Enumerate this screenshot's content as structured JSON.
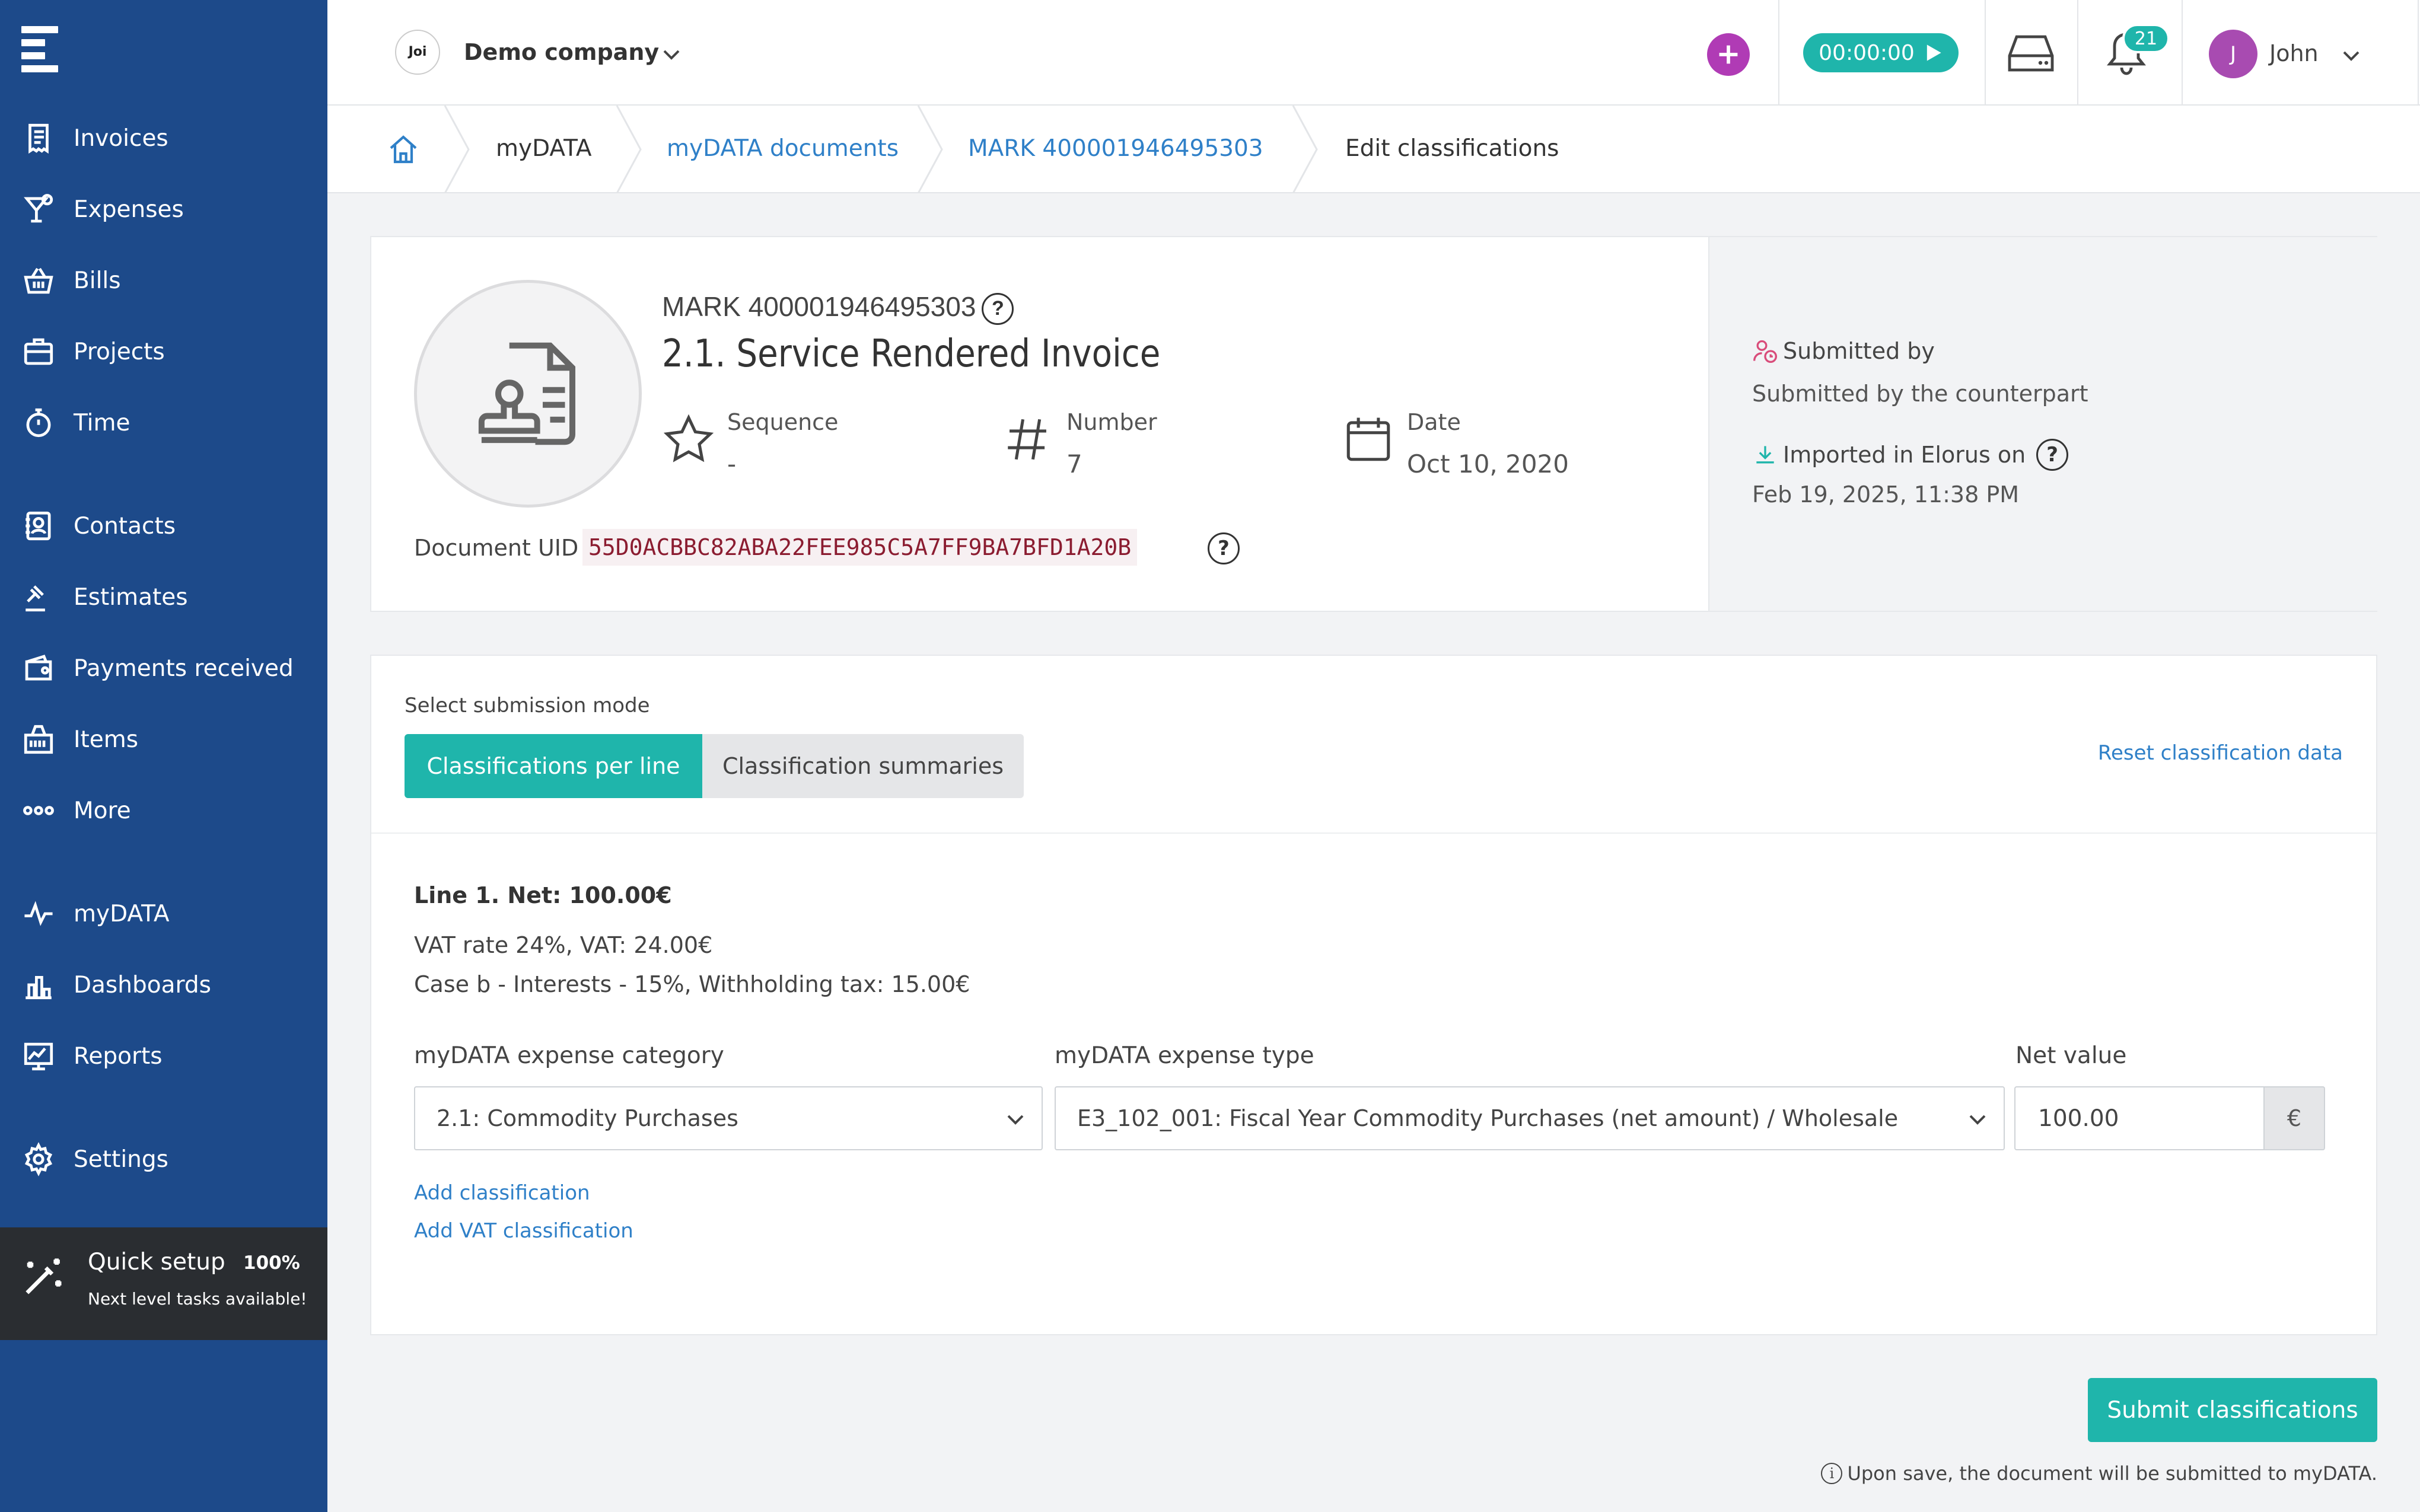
{
  "sidebar": {
    "items": [
      {
        "label": "Invoices",
        "icon": "invoice-icon"
      },
      {
        "label": "Expenses",
        "icon": "cocktail-icon"
      },
      {
        "label": "Bills",
        "icon": "basket-icon"
      },
      {
        "label": "Projects",
        "icon": "briefcase-icon"
      },
      {
        "label": "Time",
        "icon": "stopwatch-icon"
      },
      {
        "label": "Contacts",
        "icon": "contact-book-icon"
      },
      {
        "label": "Estimates",
        "icon": "gavel-icon"
      },
      {
        "label": "Payments received",
        "icon": "wallet-icon"
      },
      {
        "label": "Items",
        "icon": "items-icon"
      },
      {
        "label": "More",
        "icon": "more-dots-icon"
      },
      {
        "label": "myDATA",
        "icon": "pulse-icon"
      },
      {
        "label": "Dashboards",
        "icon": "dashboard-icon"
      },
      {
        "label": "Reports",
        "icon": "report-icon"
      },
      {
        "label": "Settings",
        "icon": "gear-icon"
      }
    ],
    "quick_setup": {
      "title": "Quick setup",
      "percent": "100%",
      "subtitle": "Next level tasks available!"
    }
  },
  "topbar": {
    "company_logo_text": "Joi",
    "company_name": "Demo company",
    "timer": "00:00:00",
    "notifications_count": "21",
    "avatar_initial": "J",
    "user_name": "John"
  },
  "breadcrumb": {
    "items": [
      "myDATA",
      "myDATA documents",
      "MARK 400001946495303",
      "Edit classifications"
    ]
  },
  "document": {
    "mark": "MARK 400001946495303",
    "title": "2.1. Service Rendered Invoice",
    "sequence_label": "Sequence",
    "sequence_value": "-",
    "number_label": "Number",
    "number_value": "7",
    "date_label": "Date",
    "date_value": "Oct 10, 2020",
    "uid_label": "Document UID",
    "uid_value": "55D0ACBBC82ABA22FEE985C5A7FF9BA7BFD1A20B",
    "submitted_by_label": "Submitted by",
    "submitted_by_value": "Submitted by the counterpart",
    "imported_label": "Imported in Elorus on",
    "imported_value": "Feb 19, 2025, 11:38 PM"
  },
  "classification": {
    "mode_label": "Select submission mode",
    "mode_active": "Classifications per line",
    "mode_inactive": "Classification summaries",
    "reset_label": "Reset classification data",
    "line_title": "Line 1. Net: 100.00€",
    "line_vat": "VAT rate 24%, VAT: 24.00€",
    "line_withholding": "Case b - Interests - 15%, Withholding tax: 15.00€",
    "category_label": "myDATA expense category",
    "category_value": "2.1: Commodity Purchases",
    "type_label": "myDATA expense type",
    "type_value": "E3_102_001: Fiscal Year Commodity Purchases (net amount) / Wholesale",
    "net_label": "Net value",
    "net_value": "100.00",
    "currency": "€",
    "add_classification": "Add classification",
    "add_vat_classification": "Add VAT classification"
  },
  "footer": {
    "submit_label": "Submit classifications",
    "info_icon_glyph": "i",
    "note": "Upon save, the document will be submitted to myDATA."
  },
  "colors": {
    "sidebar": "#1d4a8a",
    "accent": "#1fb5ab",
    "link": "#2f80c8",
    "plus": "#b03bb5",
    "uid_text": "#8b1c30"
  }
}
